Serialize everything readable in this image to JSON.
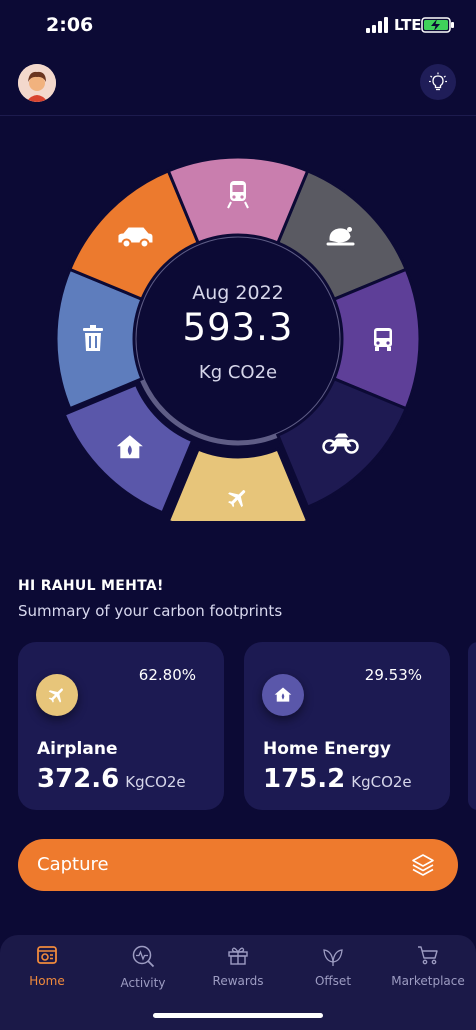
{
  "status_bar": {
    "time": "2:06",
    "network": "LTE"
  },
  "header": {
    "avatar_icon": "user-avatar",
    "hint_icon": "lightbulb-icon"
  },
  "footprint_chart": {
    "period": "Aug 2022",
    "total": "593.3",
    "unit": "Kg CO2e",
    "segments": [
      {
        "name": "food",
        "icon": "chicken-icon",
        "color": "#5a5a62"
      },
      {
        "name": "bus",
        "icon": "bus-icon",
        "color": "#5e3f98"
      },
      {
        "name": "motorbike",
        "icon": "motorbike-icon",
        "color": "#1e1a52"
      },
      {
        "name": "airplane",
        "icon": "airplane-icon",
        "color": "#e7c57a"
      },
      {
        "name": "home-energy",
        "icon": "home-energy-icon",
        "color": "#5a57aa"
      },
      {
        "name": "waste",
        "icon": "trash-icon",
        "color": "#5e7dbd"
      },
      {
        "name": "car",
        "icon": "car-icon",
        "color": "#ec7a2e"
      },
      {
        "name": "train",
        "icon": "train-icon",
        "color": "#c97eae"
      }
    ]
  },
  "greeting": {
    "title": "HI RAHUL MEHTA!",
    "subtitle": "Summary of your carbon footprints"
  },
  "cards": [
    {
      "name": "Airplane",
      "percent": "62.80%",
      "value": "372.6",
      "unit": "KgCO2e",
      "icon": "airplane-icon",
      "color": "#e7c57a"
    },
    {
      "name": "Home Energy",
      "percent": "29.53%",
      "value": "175.2",
      "unit": "KgCO2e",
      "icon": "home-energy-icon",
      "color": "#5a57aa"
    }
  ],
  "capture": {
    "label": "Capture",
    "icon": "layers-icon"
  },
  "tabs": [
    {
      "label": "Home",
      "icon": "home-tab-icon",
      "active": true
    },
    {
      "label": "Activity",
      "icon": "activity-search-icon",
      "active": false
    },
    {
      "label": "Rewards",
      "icon": "gift-icon",
      "active": false
    },
    {
      "label": "Offset",
      "icon": "leaves-icon",
      "active": false
    },
    {
      "label": "Marketplace",
      "icon": "cart-icon",
      "active": false
    }
  ],
  "colors": {
    "background": "#0c0a35",
    "accent": "#ee7a2d",
    "card": "#1c1a52",
    "tabbar": "#1b1948"
  }
}
